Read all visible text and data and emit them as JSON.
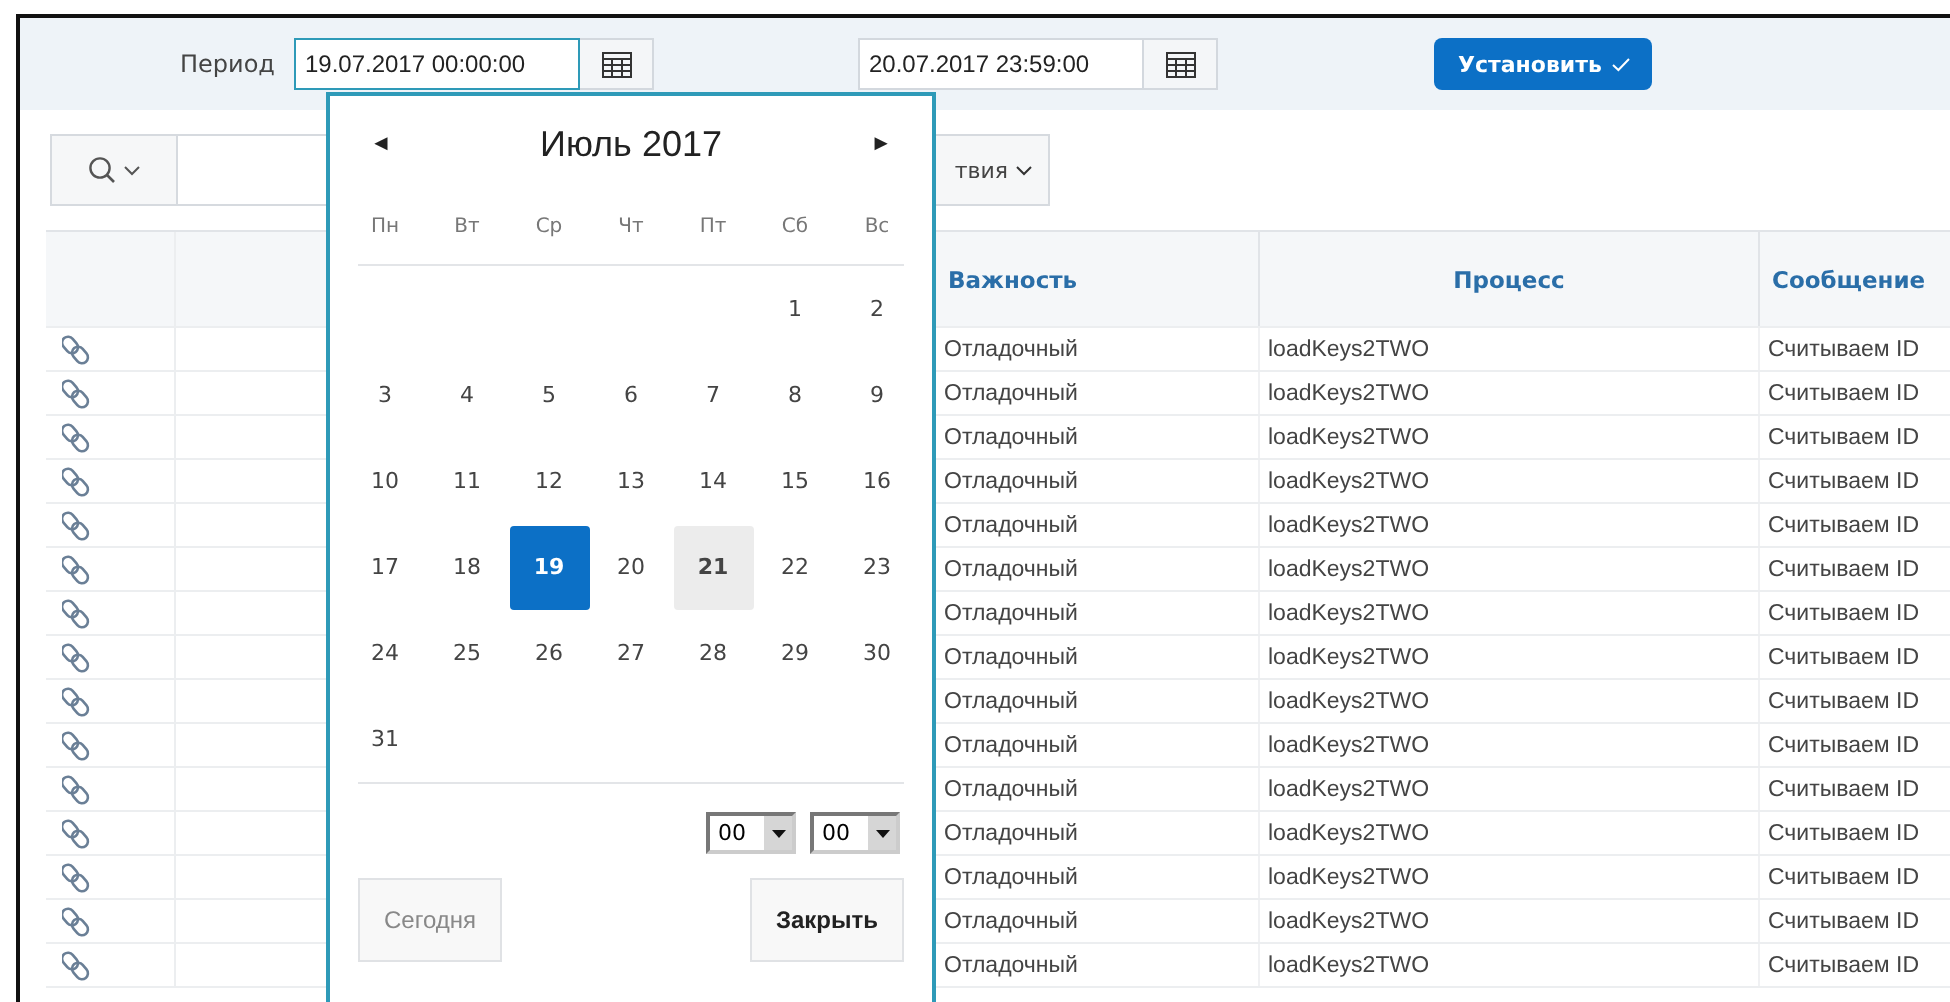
{
  "period": {
    "label": "Период",
    "from": "19.07.2017 00:00:00",
    "to": "20.07.2017 23:59:00",
    "apply_button": "Установить"
  },
  "toolbar": {
    "actions_button": "твия"
  },
  "table": {
    "columns": [
      "Важность",
      "Процесс",
      "Сообщение"
    ],
    "rows": [
      {
        "severity": "Отладочный",
        "process": "loadKeys2TWO",
        "message": "Считываем ID"
      },
      {
        "severity": "Отладочный",
        "process": "loadKeys2TWO",
        "message": "Считываем ID"
      },
      {
        "severity": "Отладочный",
        "process": "loadKeys2TWO",
        "message": "Считываем ID"
      },
      {
        "severity": "Отладочный",
        "process": "loadKeys2TWO",
        "message": "Считываем ID"
      },
      {
        "severity": "Отладочный",
        "process": "loadKeys2TWO",
        "message": "Считываем ID"
      },
      {
        "severity": "Отладочный",
        "process": "loadKeys2TWO",
        "message": "Считываем ID"
      },
      {
        "severity": "Отладочный",
        "process": "loadKeys2TWO",
        "message": "Считываем ID"
      },
      {
        "severity": "Отладочный",
        "process": "loadKeys2TWO",
        "message": "Считываем ID"
      },
      {
        "severity": "Отладочный",
        "process": "loadKeys2TWO",
        "message": "Считываем ID"
      },
      {
        "severity": "Отладочный",
        "process": "loadKeys2TWO",
        "message": "Считываем ID"
      },
      {
        "severity": "Отладочный",
        "process": "loadKeys2TWO",
        "message": "Считываем ID"
      },
      {
        "severity": "Отладочный",
        "process": "loadKeys2TWO",
        "message": "Считываем ID"
      },
      {
        "severity": "Отладочный",
        "process": "loadKeys2TWO",
        "message": "Считываем ID"
      },
      {
        "severity": "Отладочный",
        "process": "loadKeys2TWO",
        "message": "Считываем ID"
      },
      {
        "severity": "Отладочный",
        "process": "loadKeys2TWO",
        "message": "Считываем ID"
      }
    ]
  },
  "calendar": {
    "prev": "◄",
    "month": "Июль 2017",
    "next": "►",
    "weekdays": [
      "Пн",
      "Вт",
      "Ср",
      "Чт",
      "Пт",
      "Сб",
      "Вс"
    ],
    "weeks": [
      {
        "right_aligned": true,
        "days": [
          {
            "day": "1",
            "selected": false,
            "highlighted": false
          },
          {
            "day": "2",
            "selected": false,
            "highlighted": false
          }
        ]
      },
      {
        "days": [
          {
            "day": "3",
            "selected": false,
            "highlighted": false
          },
          {
            "day": "4",
            "selected": false,
            "highlighted": false
          },
          {
            "day": "5",
            "selected": false,
            "highlighted": false
          },
          {
            "day": "6",
            "selected": false,
            "highlighted": false
          },
          {
            "day": "7",
            "selected": false,
            "highlighted": false
          },
          {
            "day": "8",
            "selected": false,
            "highlighted": false
          },
          {
            "day": "9",
            "selected": false,
            "highlighted": false
          }
        ]
      },
      {
        "days": [
          {
            "day": "10",
            "selected": false,
            "highlighted": false
          },
          {
            "day": "11",
            "selected": false,
            "highlighted": false
          },
          {
            "day": "12",
            "selected": false,
            "highlighted": false
          },
          {
            "day": "13",
            "selected": false,
            "highlighted": false
          },
          {
            "day": "14",
            "selected": false,
            "highlighted": false
          },
          {
            "day": "15",
            "selected": false,
            "highlighted": false
          },
          {
            "day": "16",
            "selected": false,
            "highlighted": false
          }
        ]
      },
      {
        "days": [
          {
            "day": "17",
            "selected": false,
            "highlighted": false
          },
          {
            "day": "18",
            "selected": false,
            "highlighted": false
          },
          {
            "day": "19",
            "selected": true,
            "highlighted": false
          },
          {
            "day": "20",
            "selected": false,
            "highlighted": false
          },
          {
            "day": "21",
            "selected": false,
            "highlighted": true
          },
          {
            "day": "22",
            "selected": false,
            "highlighted": false
          },
          {
            "day": "23",
            "selected": false,
            "highlighted": false
          }
        ]
      },
      {
        "days": [
          {
            "day": "24",
            "selected": false,
            "highlighted": false
          },
          {
            "day": "25",
            "selected": false,
            "highlighted": false
          },
          {
            "day": "26",
            "selected": false,
            "highlighted": false
          },
          {
            "day": "27",
            "selected": false,
            "highlighted": false
          },
          {
            "day": "28",
            "selected": false,
            "highlighted": false
          },
          {
            "day": "29",
            "selected": false,
            "highlighted": false
          },
          {
            "day": "30",
            "selected": false,
            "highlighted": false
          }
        ]
      },
      {
        "right_aligned": false,
        "days": [
          {
            "day": "31",
            "selected": false,
            "highlighted": false
          }
        ]
      }
    ],
    "hour": "00",
    "minute": "00",
    "today_button": "Сегодня",
    "close_button": "Закрыть"
  }
}
